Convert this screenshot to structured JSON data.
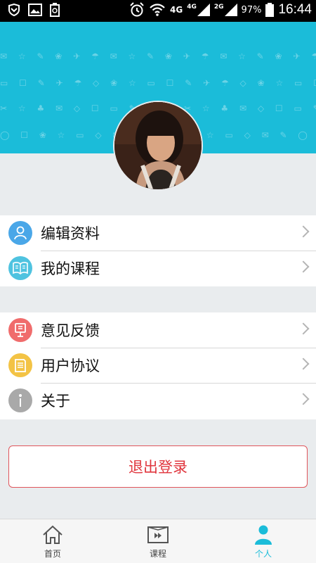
{
  "status_bar": {
    "network_4g": "4G",
    "network_4g_small": "4G",
    "network_2g_small": "2G",
    "battery_percent": "97%",
    "time": "16:44"
  },
  "profile": {
    "banner_color": "#1bbcd9"
  },
  "menu_group_1": [
    {
      "label": "编辑资料",
      "icon": "user-icon",
      "icon_color": "#4aa7e8"
    },
    {
      "label": "我的课程",
      "icon": "book-icon",
      "icon_color": "#4fc3e0"
    }
  ],
  "menu_group_2": [
    {
      "label": "意见反馈",
      "icon": "feedback-icon",
      "icon_color": "#f06c6c"
    },
    {
      "label": "用户协议",
      "icon": "document-icon",
      "icon_color": "#f3c345"
    },
    {
      "label": "关于",
      "icon": "info-icon",
      "icon_color": "#a9a9a9"
    }
  ],
  "logout_label": "退出登录",
  "bottom_nav": [
    {
      "label": "首页",
      "icon": "home-icon",
      "active": false
    },
    {
      "label": "课程",
      "icon": "course-play-icon",
      "active": false
    },
    {
      "label": "个人",
      "icon": "person-icon",
      "active": true
    }
  ]
}
